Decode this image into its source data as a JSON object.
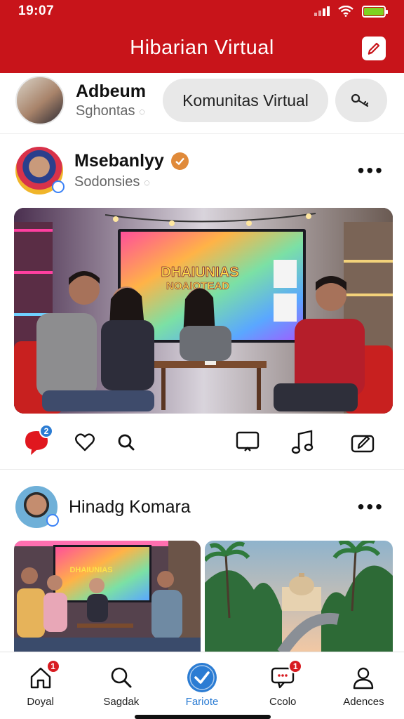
{
  "status": {
    "time": "19:07"
  },
  "header": {
    "title": "Hibarian Virtual"
  },
  "story": {
    "name": "Adbeum",
    "handle": "Sghontas",
    "community_label": "Komunitas Virtual"
  },
  "post1": {
    "name": "Msebanlyy",
    "handle": "Sodonsies",
    "image_texts": [
      "DHAIUNIAS",
      "NOAIOTEAD"
    ],
    "notification_count": "2"
  },
  "post2": {
    "name": "Hinadg Komara",
    "image_texts": [
      "DHAIUNIAS"
    ]
  },
  "nav": {
    "items": [
      {
        "label": "Doyal",
        "icon": "home-icon",
        "badge": "1"
      },
      {
        "label": "Sagdak",
        "icon": "search-icon",
        "badge": ""
      },
      {
        "label": "Fariote",
        "icon": "check-circle-icon",
        "badge": ""
      },
      {
        "label": "Ccolo",
        "icon": "chat-icon",
        "badge": "1"
      },
      {
        "label": "Adences",
        "icon": "profile-icon",
        "badge": ""
      }
    ]
  },
  "colors": {
    "brand": "#c8141a",
    "accent": "#2b7cd3",
    "verified": "#e08a3a"
  }
}
